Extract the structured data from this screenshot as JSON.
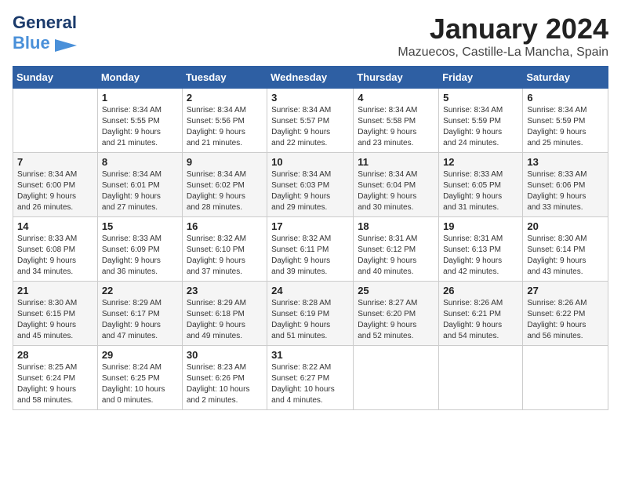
{
  "header": {
    "logo_general": "General",
    "logo_blue": "Blue",
    "title": "January 2024",
    "subtitle": "Mazuecos, Castille-La Mancha, Spain"
  },
  "days_of_week": [
    "Sunday",
    "Monday",
    "Tuesday",
    "Wednesday",
    "Thursday",
    "Friday",
    "Saturday"
  ],
  "weeks": [
    [
      {
        "day": "",
        "info": ""
      },
      {
        "day": "1",
        "info": "Sunrise: 8:34 AM\nSunset: 5:55 PM\nDaylight: 9 hours\nand 21 minutes."
      },
      {
        "day": "2",
        "info": "Sunrise: 8:34 AM\nSunset: 5:56 PM\nDaylight: 9 hours\nand 21 minutes."
      },
      {
        "day": "3",
        "info": "Sunrise: 8:34 AM\nSunset: 5:57 PM\nDaylight: 9 hours\nand 22 minutes."
      },
      {
        "day": "4",
        "info": "Sunrise: 8:34 AM\nSunset: 5:58 PM\nDaylight: 9 hours\nand 23 minutes."
      },
      {
        "day": "5",
        "info": "Sunrise: 8:34 AM\nSunset: 5:59 PM\nDaylight: 9 hours\nand 24 minutes."
      },
      {
        "day": "6",
        "info": "Sunrise: 8:34 AM\nSunset: 5:59 PM\nDaylight: 9 hours\nand 25 minutes."
      }
    ],
    [
      {
        "day": "7",
        "info": "Sunrise: 8:34 AM\nSunset: 6:00 PM\nDaylight: 9 hours\nand 26 minutes."
      },
      {
        "day": "8",
        "info": "Sunrise: 8:34 AM\nSunset: 6:01 PM\nDaylight: 9 hours\nand 27 minutes."
      },
      {
        "day": "9",
        "info": "Sunrise: 8:34 AM\nSunset: 6:02 PM\nDaylight: 9 hours\nand 28 minutes."
      },
      {
        "day": "10",
        "info": "Sunrise: 8:34 AM\nSunset: 6:03 PM\nDaylight: 9 hours\nand 29 minutes."
      },
      {
        "day": "11",
        "info": "Sunrise: 8:34 AM\nSunset: 6:04 PM\nDaylight: 9 hours\nand 30 minutes."
      },
      {
        "day": "12",
        "info": "Sunrise: 8:33 AM\nSunset: 6:05 PM\nDaylight: 9 hours\nand 31 minutes."
      },
      {
        "day": "13",
        "info": "Sunrise: 8:33 AM\nSunset: 6:06 PM\nDaylight: 9 hours\nand 33 minutes."
      }
    ],
    [
      {
        "day": "14",
        "info": "Sunrise: 8:33 AM\nSunset: 6:08 PM\nDaylight: 9 hours\nand 34 minutes."
      },
      {
        "day": "15",
        "info": "Sunrise: 8:33 AM\nSunset: 6:09 PM\nDaylight: 9 hours\nand 36 minutes."
      },
      {
        "day": "16",
        "info": "Sunrise: 8:32 AM\nSunset: 6:10 PM\nDaylight: 9 hours\nand 37 minutes."
      },
      {
        "day": "17",
        "info": "Sunrise: 8:32 AM\nSunset: 6:11 PM\nDaylight: 9 hours\nand 39 minutes."
      },
      {
        "day": "18",
        "info": "Sunrise: 8:31 AM\nSunset: 6:12 PM\nDaylight: 9 hours\nand 40 minutes."
      },
      {
        "day": "19",
        "info": "Sunrise: 8:31 AM\nSunset: 6:13 PM\nDaylight: 9 hours\nand 42 minutes."
      },
      {
        "day": "20",
        "info": "Sunrise: 8:30 AM\nSunset: 6:14 PM\nDaylight: 9 hours\nand 43 minutes."
      }
    ],
    [
      {
        "day": "21",
        "info": "Sunrise: 8:30 AM\nSunset: 6:15 PM\nDaylight: 9 hours\nand 45 minutes."
      },
      {
        "day": "22",
        "info": "Sunrise: 8:29 AM\nSunset: 6:17 PM\nDaylight: 9 hours\nand 47 minutes."
      },
      {
        "day": "23",
        "info": "Sunrise: 8:29 AM\nSunset: 6:18 PM\nDaylight: 9 hours\nand 49 minutes."
      },
      {
        "day": "24",
        "info": "Sunrise: 8:28 AM\nSunset: 6:19 PM\nDaylight: 9 hours\nand 51 minutes."
      },
      {
        "day": "25",
        "info": "Sunrise: 8:27 AM\nSunset: 6:20 PM\nDaylight: 9 hours\nand 52 minutes."
      },
      {
        "day": "26",
        "info": "Sunrise: 8:26 AM\nSunset: 6:21 PM\nDaylight: 9 hours\nand 54 minutes."
      },
      {
        "day": "27",
        "info": "Sunrise: 8:26 AM\nSunset: 6:22 PM\nDaylight: 9 hours\nand 56 minutes."
      }
    ],
    [
      {
        "day": "28",
        "info": "Sunrise: 8:25 AM\nSunset: 6:24 PM\nDaylight: 9 hours\nand 58 minutes."
      },
      {
        "day": "29",
        "info": "Sunrise: 8:24 AM\nSunset: 6:25 PM\nDaylight: 10 hours\nand 0 minutes."
      },
      {
        "day": "30",
        "info": "Sunrise: 8:23 AM\nSunset: 6:26 PM\nDaylight: 10 hours\nand 2 minutes."
      },
      {
        "day": "31",
        "info": "Sunrise: 8:22 AM\nSunset: 6:27 PM\nDaylight: 10 hours\nand 4 minutes."
      },
      {
        "day": "",
        "info": ""
      },
      {
        "day": "",
        "info": ""
      },
      {
        "day": "",
        "info": ""
      }
    ]
  ]
}
